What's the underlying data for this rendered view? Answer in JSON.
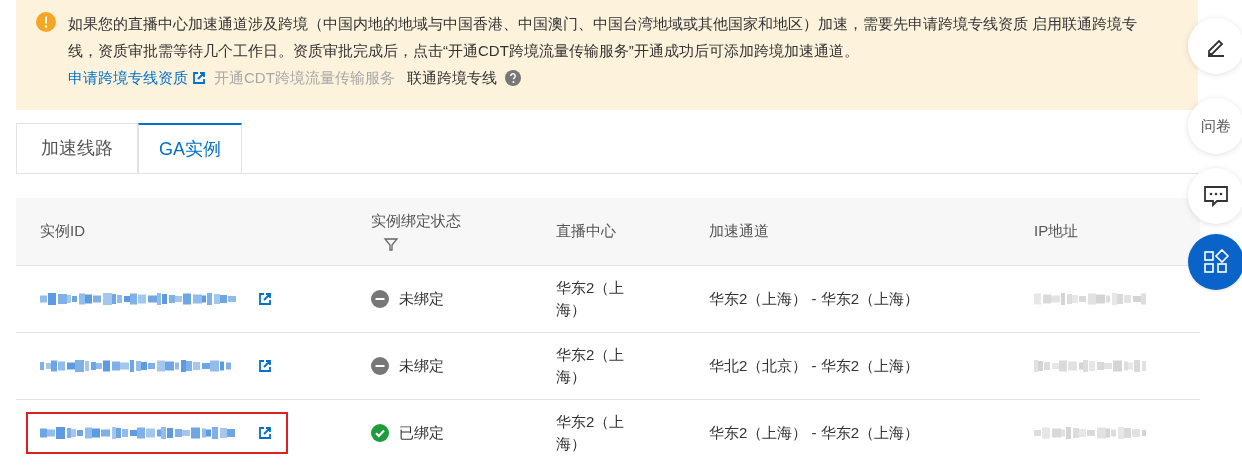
{
  "notice": {
    "text": "如果您的直播中心加速通道涉及跨境（中国内地的地域与中国香港、中国澳门、中国台湾地域或其他国家和地区）加速，需要先申请跨境专线资质 启用联通跨境专线，资质审批需等待几个工作日。资质审批完成后，点击“开通CDT跨境流量传输服务”开通成功后可添加跨境加速通道。",
    "link": "申请跨境专线资质",
    "disabled_link": "开通CDT跨境流量传输服务",
    "label": "联通跨境专线"
  },
  "tabs": [
    {
      "label": "加速线路",
      "selected": false
    },
    {
      "label": "GA实例",
      "selected": true
    }
  ],
  "table": {
    "columns": [
      "实例ID",
      "实例绑定状态",
      "直播中心",
      "加速通道",
      "IP地址"
    ],
    "rows": [
      {
        "bound": false,
        "status": "未绑定",
        "center": "华东2（上海）",
        "channel": "华东2（上海） - 华东2（上海）",
        "highlighted": false
      },
      {
        "bound": false,
        "status": "未绑定",
        "center": "华东2（上海）",
        "channel": "华北2（北京） - 华东2（上海）",
        "highlighted": false
      },
      {
        "bound": true,
        "status": "已绑定",
        "center": "华东2（上海）",
        "channel": "华东2（上海） - 华东2（上海）",
        "highlighted": true
      }
    ]
  },
  "float_buttons": [
    {
      "kind": "edit"
    },
    {
      "kind": "survey",
      "label": "问卷"
    },
    {
      "kind": "chat"
    },
    {
      "kind": "apps"
    }
  ]
}
